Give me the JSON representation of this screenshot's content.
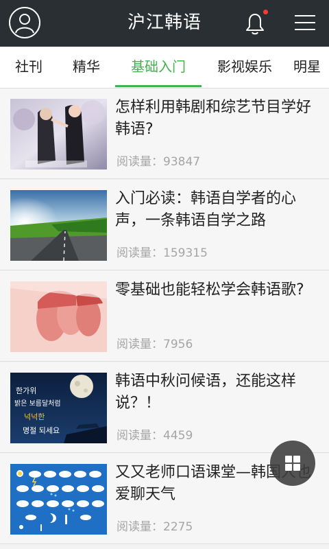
{
  "app": {
    "title": "沪江韩语"
  },
  "header": {
    "avatar_icon": "user-avatar-icon",
    "bell_icon": "bell-icon",
    "menu_icon": "hamburger-menu-icon",
    "notification_dot_color": "#ff3b30"
  },
  "tabs": [
    {
      "label": "社刊"
    },
    {
      "label": "精华"
    },
    {
      "label": "基础入门",
      "active": true
    },
    {
      "label": "影视娱乐"
    },
    {
      "label": "明星"
    }
  ],
  "accent_color": "#41b34b",
  "articles": [
    {
      "title": "怎样利用韩剧和综艺节目学好韩语?",
      "reads_label": "阅读量：",
      "reads": "93847"
    },
    {
      "title": "入门必读：韩语自学者的心声，一条韩语自学之路",
      "reads_label": "阅读量：",
      "reads": "159315"
    },
    {
      "title": "零基础也能轻松学会韩语歌?",
      "reads_label": "阅读量：",
      "reads": "7956"
    },
    {
      "title": "韩语中秋问候语，还能这样说？！",
      "reads_label": "阅读量：",
      "reads": "4459"
    },
    {
      "title": "又又老师口语课堂—韩国人也爱聊天气",
      "reads_label": "阅读量：",
      "reads": "2275"
    }
  ],
  "thumbnail_text": {
    "chuseok": [
      "한가위",
      "밝은 보름달처럼",
      "넉넉한",
      "명절 되세요"
    ]
  },
  "fab": {
    "icon": "grid-apps-icon"
  }
}
